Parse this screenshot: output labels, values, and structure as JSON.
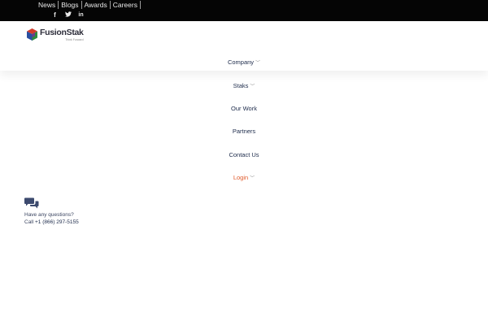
{
  "topbar": {
    "links": [
      "News",
      "Blogs",
      "Awards",
      "Careers"
    ],
    "social": [
      {
        "icon": "facebook-icon",
        "glyph": "f"
      },
      {
        "icon": "twitter-icon",
        "glyph": "🐦"
      },
      {
        "icon": "linkedin-icon",
        "glyph": "in"
      }
    ]
  },
  "brand": {
    "name": "FusionStak",
    "tagline": "Think Forward",
    "colors": {
      "red": "#d23a2a",
      "green": "#2e8a3e",
      "blue": "#2a4fa0",
      "navy": "#2d2d3a"
    }
  },
  "nav": {
    "items": [
      {
        "label": "Company",
        "dropdown": true
      },
      {
        "label": "Staks",
        "dropdown": true
      },
      {
        "label": "Our Work",
        "dropdown": false
      },
      {
        "label": "Partners",
        "dropdown": false
      },
      {
        "label": "Contact Us",
        "dropdown": false
      },
      {
        "label": "Login",
        "dropdown": true
      }
    ],
    "chevron": "﹀",
    "accent": "#e05a2b"
  },
  "contact": {
    "question": "Have any questions?",
    "call_prefix": "Call",
    "phone": "+1 (866) 297-5155"
  }
}
